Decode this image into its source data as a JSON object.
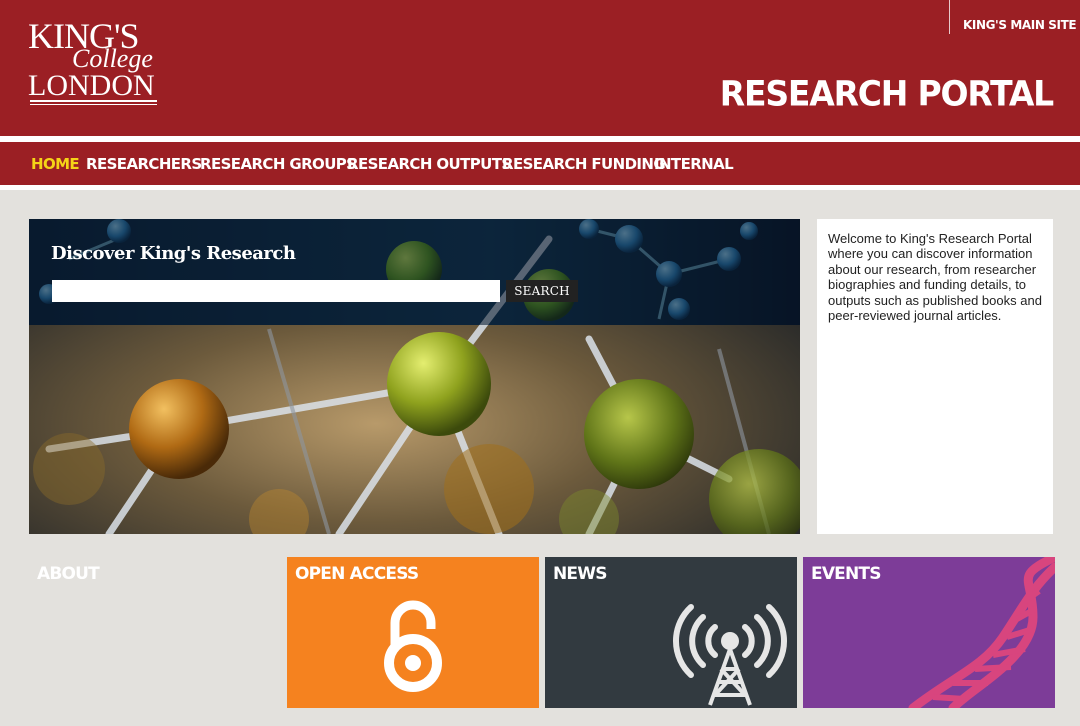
{
  "header": {
    "logo": {
      "line1": "KING'S",
      "line2": "College",
      "line3": "LONDON"
    },
    "main_site_link": "KING'S MAIN SITE",
    "portal_title": "RESEARCH PORTAL"
  },
  "nav": {
    "items": [
      {
        "label": "HOME",
        "active": true
      },
      {
        "label": "RESEARCHERS"
      },
      {
        "label": "RESEARCH GROUPS"
      },
      {
        "label": "RESEARCH OUTPUTS"
      },
      {
        "label": "RESEARCH FUNDING"
      },
      {
        "label": "INTERNAL"
      }
    ]
  },
  "hero": {
    "title": "Discover King's Research",
    "search_placeholder": "",
    "search_button": "SEARCH"
  },
  "welcome": {
    "text": "Welcome to King's Research Portal where you can discover information about our research, from researcher biographies and funding details, to outputs such as published books and peer-reviewed journal articles."
  },
  "tiles": [
    {
      "label": "ABOUT",
      "icon": "none"
    },
    {
      "label": "OPEN ACCESS",
      "icon": "open-access-lock-icon",
      "color": "#f5821f"
    },
    {
      "label": "NEWS",
      "icon": "broadcast-tower-icon",
      "color": "#323a40"
    },
    {
      "label": "EVENTS",
      "icon": "dna-helix-icon",
      "color": "#7d3c98"
    }
  ],
  "colors": {
    "brand_red": "#9b1f24",
    "nav_active": "#f5d417",
    "page_bg": "#e3e1dd"
  }
}
